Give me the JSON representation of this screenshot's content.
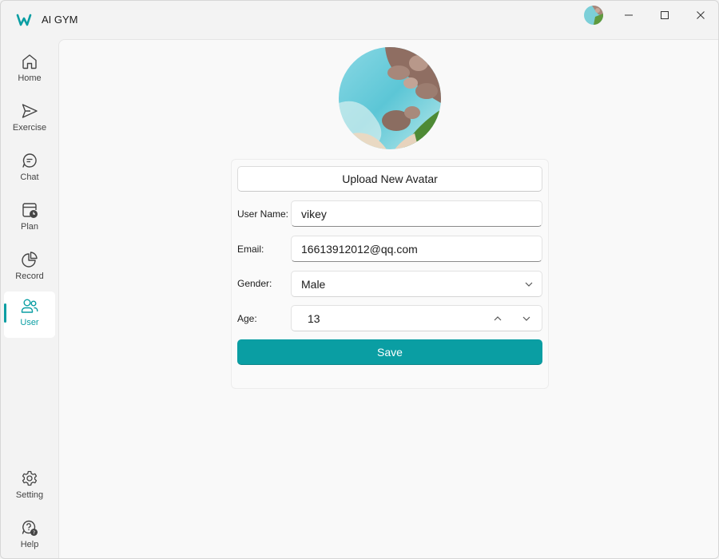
{
  "window": {
    "title": "AI GYM"
  },
  "sidebar": {
    "items": [
      {
        "label": "Home",
        "icon": "home-icon"
      },
      {
        "label": "Exercise",
        "icon": "send-icon"
      },
      {
        "label": "Chat",
        "icon": "chat-icon"
      },
      {
        "label": "Plan",
        "icon": "calendar-clock-icon"
      },
      {
        "label": "Record",
        "icon": "pie-chart-icon"
      },
      {
        "label": "User",
        "icon": "users-icon",
        "active": true
      }
    ],
    "bottom_items": [
      {
        "label": "Setting",
        "icon": "gear-icon"
      },
      {
        "label": "Help",
        "icon": "help-chat-icon"
      }
    ]
  },
  "profile": {
    "upload_label": "Upload New Avatar",
    "username_label": "User Name:",
    "username_value": "vikey",
    "email_label": "Email:",
    "email_value": "16613912012@qq.com",
    "gender_label": "Gender:",
    "gender_value": "Male",
    "age_label": "Age:",
    "age_value": "13",
    "save_label": "Save"
  },
  "colors": {
    "accent": "#0a9ea3",
    "background": "#f3f3f3",
    "content_background": "#f9f9f9"
  }
}
